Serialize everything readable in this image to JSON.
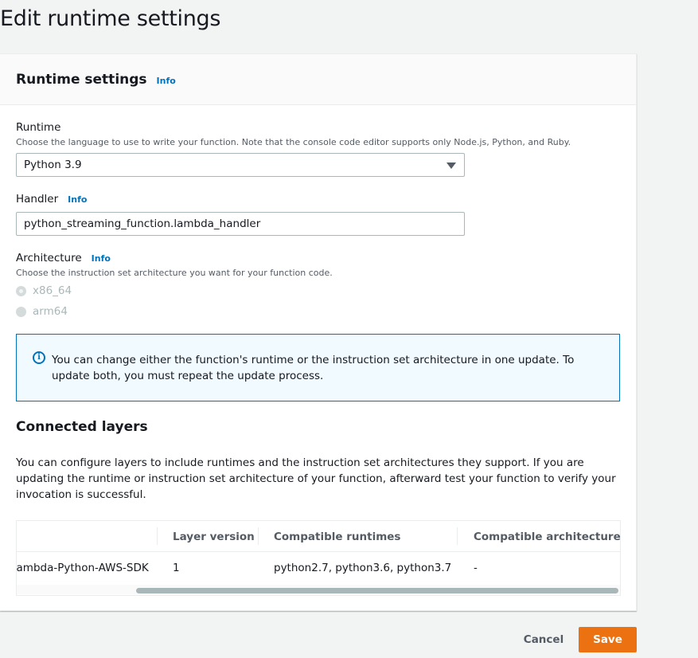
{
  "page": {
    "title": "Edit runtime settings"
  },
  "runtime_settings": {
    "title": "Runtime settings",
    "info_label": "Info",
    "runtime": {
      "label": "Runtime",
      "description": "Choose the language to use to write your function. Note that the console code editor supports only Node.js, Python, and Ruby.",
      "selected": "Python 3.9"
    },
    "handler": {
      "label": "Handler",
      "info_label": "Info",
      "value": "python_streaming_function.lambda_handler"
    },
    "architecture": {
      "label": "Architecture",
      "info_label": "Info",
      "description": "Choose the instruction set architecture you want for your function code.",
      "options": [
        {
          "label": "x86_64",
          "checked": true,
          "disabled": true
        },
        {
          "label": "arm64",
          "checked": false,
          "disabled": true
        }
      ]
    },
    "alert": {
      "icon": "info-circle-icon",
      "text": "You can change either the function's runtime or the instruction set architecture in one update. To update both, you must repeat the update process."
    }
  },
  "connected_layers": {
    "title": "Connected layers",
    "description": "You can configure layers to include runtimes and the instruction set architectures they support. If you are updating the runtime or instruction set architecture of your function, afterward test your function to verify your invocation is successful.",
    "table": {
      "columns": [
        "Layer version",
        "Compatible runtimes",
        "Compatible architectures"
      ],
      "rows": [
        {
          "name": "Lambda-Python-AWS-SDK",
          "version": "1",
          "runtimes": "python2.7, python3.6, python3.7",
          "architectures": "-"
        }
      ]
    }
  },
  "footer": {
    "cancel_label": "Cancel",
    "save_label": "Save"
  },
  "colors": {
    "accent": "#0073bb",
    "primary_button": "#ec7211",
    "alert_bg": "#f1faff"
  }
}
